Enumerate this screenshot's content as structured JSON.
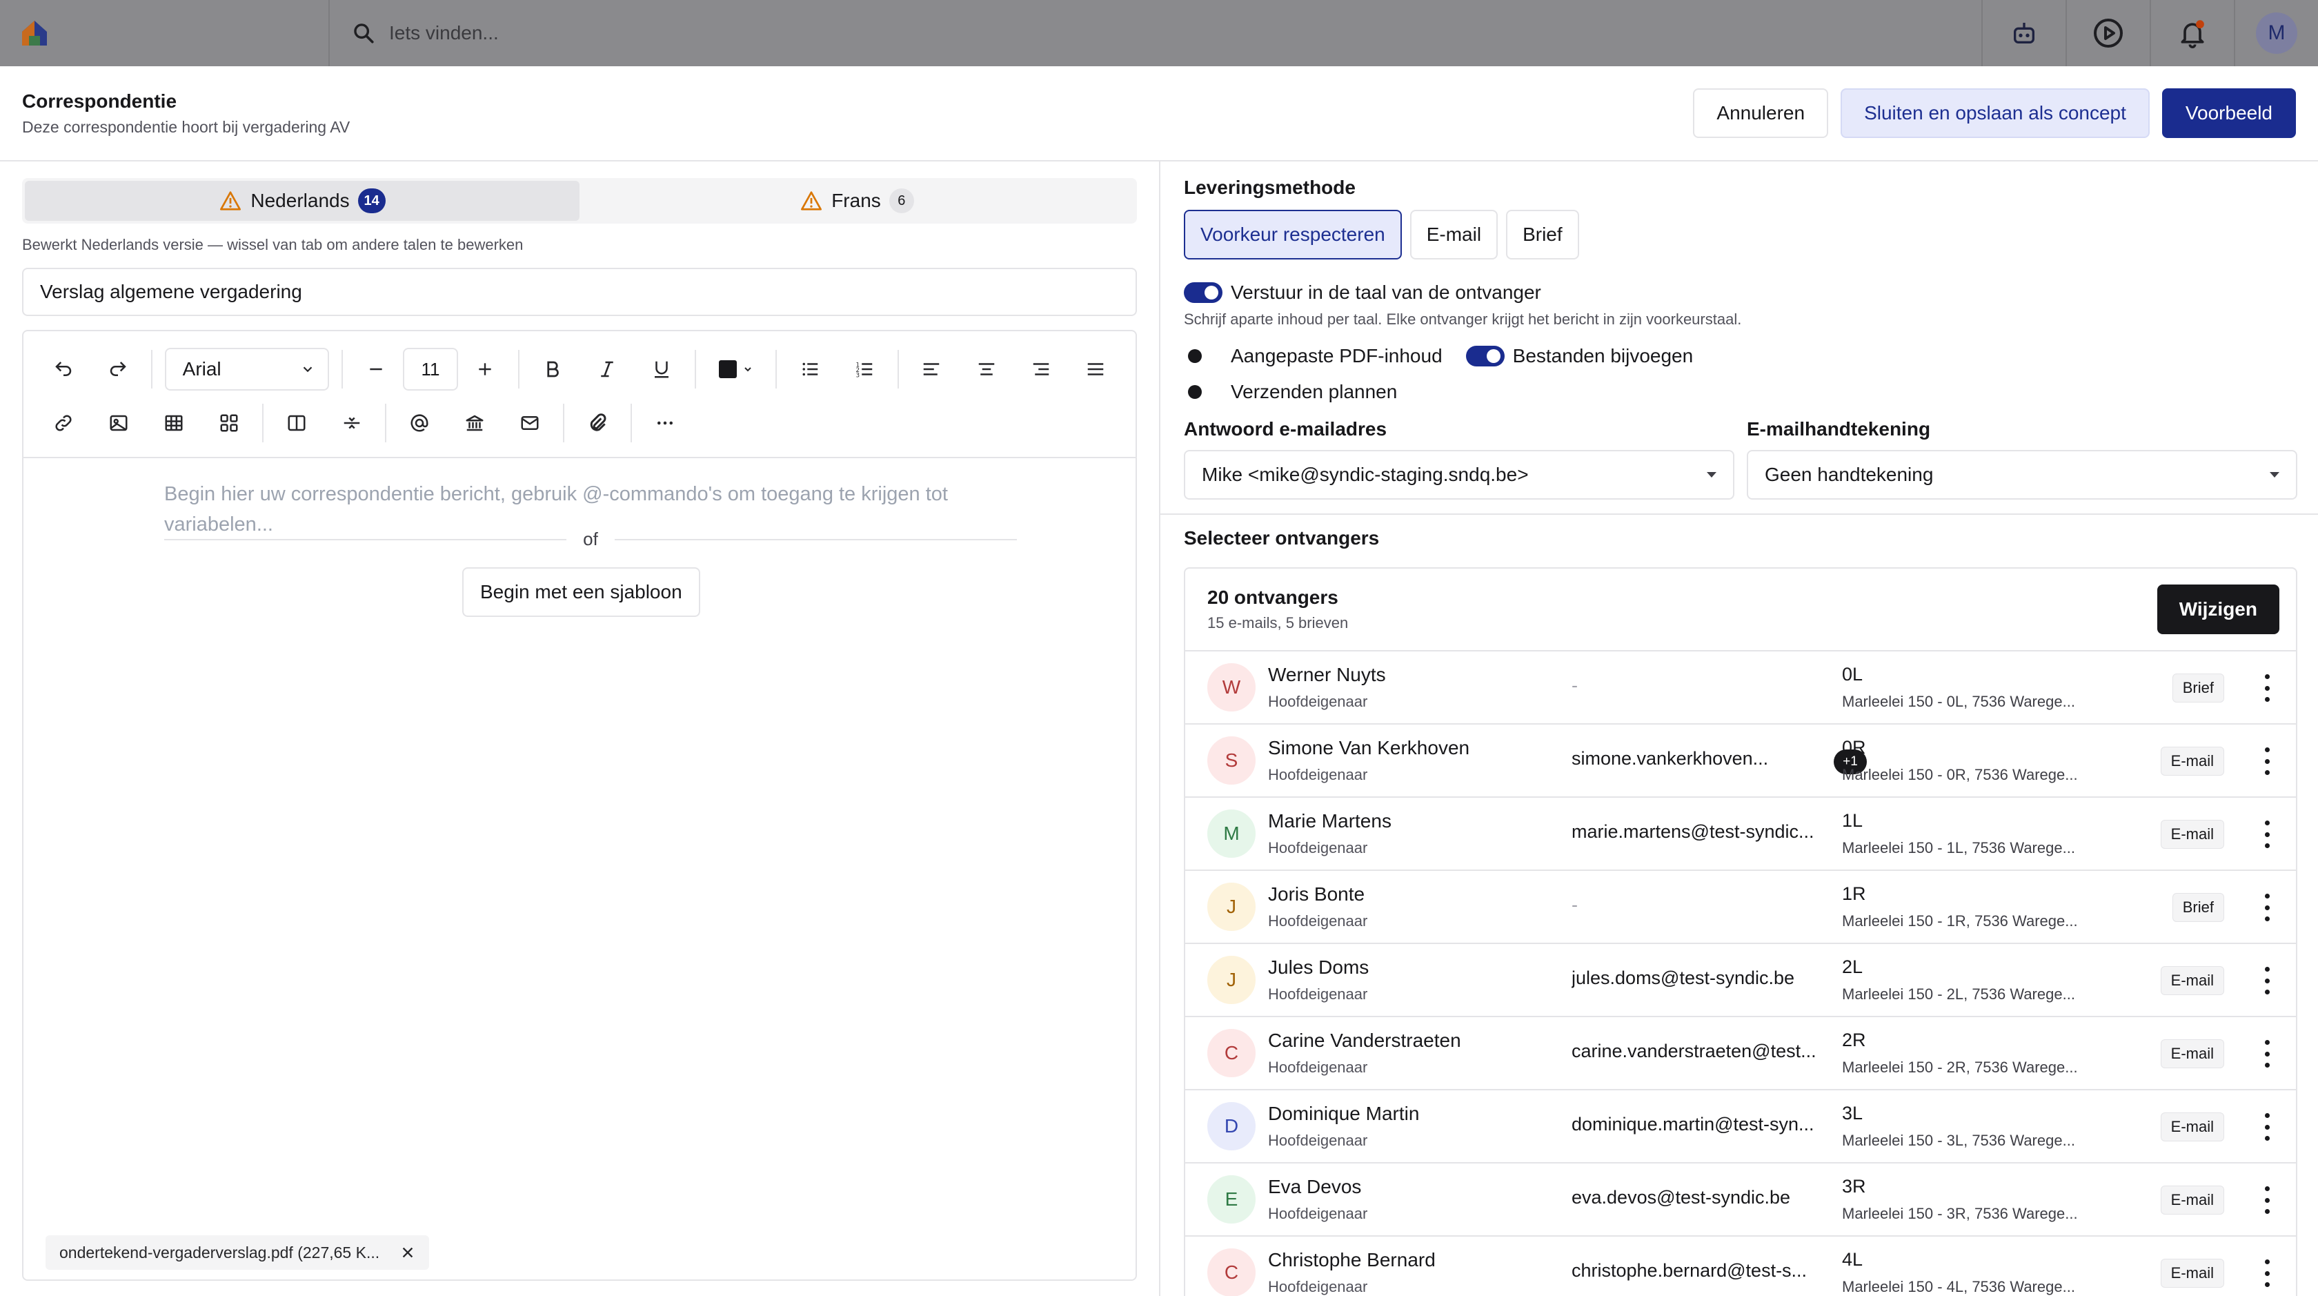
{
  "topbar": {
    "search_placeholder": "Iets vinden...",
    "avatar_initial": "M"
  },
  "modal": {
    "title": "Correspondentie",
    "subtitle": "Deze correspondentie hoort bij vergadering AV",
    "cancel_label": "Annuleren",
    "save_draft_label": "Sluiten en opslaan als concept",
    "preview_label": "Voorbeeld"
  },
  "left": {
    "tabs": [
      {
        "label": "Nederlands",
        "count": "14"
      },
      {
        "label": "Frans",
        "count": "6"
      }
    ],
    "edit_note": "Bewerkt Nederlands versie — wissel van tab om andere talen te bewerken",
    "subject": "Verslag algemene vergadering",
    "font_name": "Arial",
    "font_size": "11",
    "editor_placeholder": "Begin hier uw correspondentie bericht, gebruik @-commando's om toegang te krijgen tot variabelen...",
    "or_label": "of",
    "template_button": "Begin met een sjabloon",
    "attachment_name": "ondertekend-vergaderverslag.pdf (227,65 K..."
  },
  "right": {
    "delivery_label": "Leveringsmethode",
    "delivery_options": [
      "Voorkeur respecteren",
      "E-mail",
      "Brief"
    ],
    "toggle_language": "Verstuur in de taal van de ontvanger",
    "toggle_language_help": "Schrijf aparte inhoud per taal. Elke ontvanger krijgt het bericht in zijn voorkeurstaal.",
    "toggle_pdf": "Aangepaste PDF-inhoud",
    "toggle_files": "Bestanden bijvoegen",
    "toggle_schedule": "Verzenden plannen",
    "reply_label": "Antwoord e-mailadres",
    "reply_value": "Mike <mike@syndic-staging.sndq.be>",
    "signature_label": "E-mailhandtekening",
    "signature_value": "Geen handtekening",
    "recipients_title": "Selecteer ontvangers",
    "recipients_count": "20 ontvangers",
    "recipients_breakdown": "15 e-mails, 5 brieven",
    "change_button": "Wijzigen"
  },
  "recipients": [
    {
      "initial": "W",
      "name": "Werner Nuyts",
      "role": "Hoofdeigenaar",
      "email": "-",
      "extra": "",
      "unit": "0L",
      "address": "Marleelei 150 - 0L, 7536 Warege...",
      "method": "Brief"
    },
    {
      "initial": "S",
      "name": "Simone Van Kerkhoven",
      "role": "Hoofdeigenaar",
      "email": "simone.vankerkhoven...",
      "extra": "+1",
      "unit": "0R",
      "address": "Marleelei 150 - 0R, 7536 Warege...",
      "method": "E-mail"
    },
    {
      "initial": "M",
      "name": "Marie Martens",
      "role": "Hoofdeigenaar",
      "email": "marie.martens@test-syndic...",
      "extra": "",
      "unit": "1L",
      "address": "Marleelei 150 - 1L, 7536 Warege...",
      "method": "E-mail"
    },
    {
      "initial": "J",
      "name": "Joris Bonte",
      "role": "Hoofdeigenaar",
      "email": "-",
      "extra": "",
      "unit": "1R",
      "address": "Marleelei 150 - 1R, 7536 Warege...",
      "method": "Brief"
    },
    {
      "initial": "J",
      "name": "Jules Doms",
      "role": "Hoofdeigenaar",
      "email": "jules.doms@test-syndic.be",
      "extra": "",
      "unit": "2L",
      "address": "Marleelei 150 - 2L, 7536 Warege...",
      "method": "E-mail"
    },
    {
      "initial": "C",
      "name": "Carine Vanderstraeten",
      "role": "Hoofdeigenaar",
      "email": "carine.vanderstraeten@test...",
      "extra": "",
      "unit": "2R",
      "address": "Marleelei 150 - 2R, 7536 Warege...",
      "method": "E-mail"
    },
    {
      "initial": "D",
      "name": "Dominique Martin",
      "role": "Hoofdeigenaar",
      "email": "dominique.martin@test-syn...",
      "extra": "",
      "unit": "3L",
      "address": "Marleelei 150 - 3L, 7536 Warege...",
      "method": "E-mail"
    },
    {
      "initial": "E",
      "name": "Eva Devos",
      "role": "Hoofdeigenaar",
      "email": "eva.devos@test-syndic.be",
      "extra": "",
      "unit": "3R",
      "address": "Marleelei 150 - 3R, 7536 Warege...",
      "method": "E-mail"
    },
    {
      "initial": "C",
      "name": "Christophe Bernard",
      "role": "Hoofdeigenaar",
      "email": "christophe.bernard@test-s...",
      "extra": "",
      "unit": "4L",
      "address": "Marleelei 150 - 4L, 7536 Warege...",
      "method": "E-mail"
    }
  ],
  "colors": {
    "accent": "#1a2c8f",
    "accent_soft": "#e6e9fb",
    "warning": "#d97706",
    "avatar_palette": [
      "#fde8e8",
      "#e6f6ea",
      "#fdf3dc",
      "#e8ebfb"
    ]
  }
}
